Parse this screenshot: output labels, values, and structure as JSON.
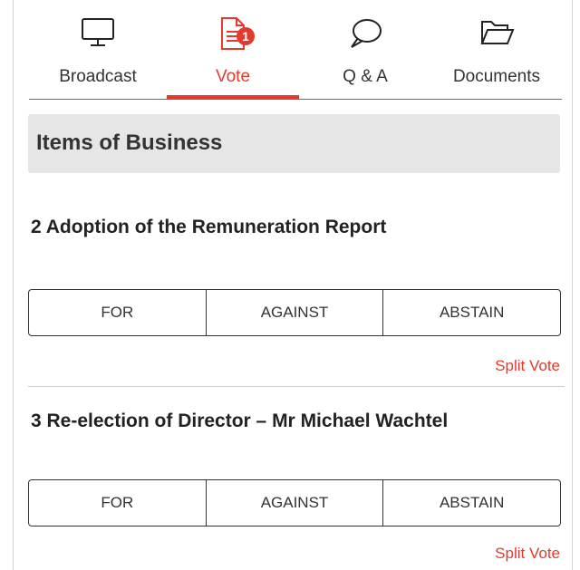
{
  "tabs": [
    {
      "label": "Broadcast",
      "icon": "monitor-icon"
    },
    {
      "label": "Vote",
      "icon": "document-icon",
      "badge": "1",
      "active": true
    },
    {
      "label": "Q & A",
      "icon": "speech-bubble-icon"
    },
    {
      "label": "Documents",
      "icon": "folder-open-icon"
    }
  ],
  "section": {
    "title": "Items of Business"
  },
  "items": [
    {
      "title": "2 Adoption of the Remuneration Report",
      "options": [
        "FOR",
        "AGAINST",
        "ABSTAIN"
      ],
      "split_label": "Split Vote"
    },
    {
      "title": "3 Re-election of Director – Mr Michael Wachtel",
      "options": [
        "FOR",
        "AGAINST",
        "ABSTAIN"
      ],
      "split_label": "Split Vote"
    }
  ],
  "colors": {
    "accent": "#e23b2e",
    "header_bg": "#e6e6e6"
  }
}
